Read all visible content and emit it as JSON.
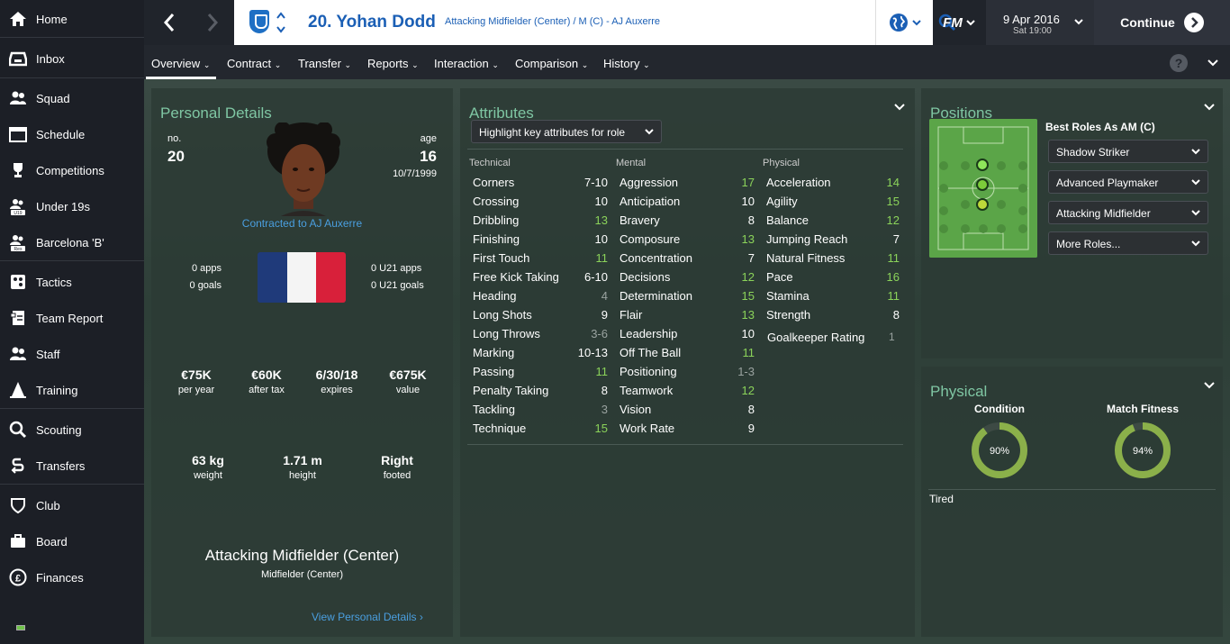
{
  "sidebar": {
    "items": [
      {
        "label": "Home",
        "icon": "home-icon"
      },
      {
        "label": "Inbox",
        "icon": "inbox-icon"
      },
      {
        "label": "Squad",
        "icon": "squad-icon"
      },
      {
        "label": "Schedule",
        "icon": "calendar-icon"
      },
      {
        "label": "Competitions",
        "icon": "trophy-icon"
      },
      {
        "label": "Under 19s",
        "icon": "under19-icon",
        "badge": "U19"
      },
      {
        "label": "Barcelona 'B'",
        "icon": "reserves-icon",
        "badge": "Res"
      },
      {
        "label": "Tactics",
        "icon": "tactics-icon"
      },
      {
        "label": "Team Report",
        "icon": "report-icon"
      },
      {
        "label": "Staff",
        "icon": "staff-icon"
      },
      {
        "label": "Training",
        "icon": "training-icon"
      },
      {
        "label": "Scouting",
        "icon": "search-icon"
      },
      {
        "label": "Transfers",
        "icon": "transfers-icon"
      },
      {
        "label": "Club",
        "icon": "shield-icon"
      },
      {
        "label": "Board",
        "icon": "briefcase-icon"
      },
      {
        "label": "Finances",
        "icon": "pound-icon"
      }
    ]
  },
  "header": {
    "player_title": "20. Yohan Dodd",
    "player_position": "Attacking Midfielder (Center) / M (C) - AJ Auxerre",
    "brand": "FM",
    "date": "9 Apr 2016",
    "time": "Sat 19:00",
    "continue_label": "Continue"
  },
  "tabs": [
    "Overview",
    "Contract",
    "Transfer",
    "Reports",
    "Interaction",
    "Comparison",
    "History"
  ],
  "help_label": "?",
  "personal": {
    "title": "Personal Details",
    "no_label": "no.",
    "no_value": "20",
    "age_label": "age",
    "age_value": "16",
    "dob": "10/7/1999",
    "contract_text": "Contracted to AJ Auxerre",
    "apps": "0 apps",
    "goals": "0 goals",
    "u21_apps": "0 U21 apps",
    "u21_goals": "0 U21 goals",
    "wage": "€75K",
    "wage_label": "per year",
    "after_tax": "€60K",
    "after_tax_label": "after tax",
    "expires": "6/30/18",
    "expires_label": "expires",
    "value": "€675K",
    "value_label": "value",
    "weight": "63 kg",
    "weight_label": "weight",
    "height": "1.71 m",
    "height_label": "height",
    "foot": "Right",
    "foot_label": "footed",
    "main_position": "Attacking Midfielder (Center)",
    "sub_position": "Midfielder (Center)",
    "view_link": "View Personal Details"
  },
  "attributes": {
    "title": "Attributes",
    "highlight_label": "Highlight key attributes for role",
    "technical_label": "Technical",
    "mental_label": "Mental",
    "physical_label": "Physical",
    "technical": [
      [
        "Corners",
        "7-10"
      ],
      [
        "Crossing",
        "10"
      ],
      [
        "Dribbling",
        "13"
      ],
      [
        "Finishing",
        "10"
      ],
      [
        "First Touch",
        "11"
      ],
      [
        "Free Kick Taking",
        "6-10"
      ],
      [
        "Heading",
        "4"
      ],
      [
        "Long Shots",
        "9"
      ],
      [
        "Long Throws",
        "3-6"
      ],
      [
        "Marking",
        "10-13"
      ],
      [
        "Passing",
        "11"
      ],
      [
        "Penalty Taking",
        "8"
      ],
      [
        "Tackling",
        "3"
      ],
      [
        "Technique",
        "15"
      ]
    ],
    "mental": [
      [
        "Aggression",
        "17"
      ],
      [
        "Anticipation",
        "10"
      ],
      [
        "Bravery",
        "8"
      ],
      [
        "Composure",
        "13"
      ],
      [
        "Concentration",
        "7"
      ],
      [
        "Decisions",
        "12"
      ],
      [
        "Determination",
        "15"
      ],
      [
        "Flair",
        "13"
      ],
      [
        "Leadership",
        "10"
      ],
      [
        "Off The Ball",
        "11"
      ],
      [
        "Positioning",
        "1-3"
      ],
      [
        "Teamwork",
        "12"
      ],
      [
        "Vision",
        "8"
      ],
      [
        "Work Rate",
        "9"
      ]
    ],
    "physical": [
      [
        "Acceleration",
        "14"
      ],
      [
        "Agility",
        "15"
      ],
      [
        "Balance",
        "12"
      ],
      [
        "Jumping Reach",
        "7"
      ],
      [
        "Natural Fitness",
        "11"
      ],
      [
        "Pace",
        "16"
      ],
      [
        "Stamina",
        "11"
      ],
      [
        "Strength",
        "8"
      ]
    ],
    "goalkeeper_label": "Goalkeeper Rating",
    "goalkeeper_value": "1"
  },
  "positions": {
    "title": "Positions",
    "best_roles": "Best Roles As AM (C)",
    "roles": [
      "Shadow Striker",
      "Advanced Playmaker",
      "Attacking Midfielder",
      "More Roles..."
    ]
  },
  "physical": {
    "title": "Physical",
    "condition_label": "Condition",
    "condition_value": "90%",
    "condition_fraction": 0.9,
    "fitness_label": "Match Fitness",
    "fitness_value": "94%",
    "fitness_fraction": 0.94,
    "status": "Tired"
  },
  "colors": {
    "accent_green": "#7fc6a3",
    "good_value": "#8bd35a",
    "low_value": "#9aa3a0",
    "link_blue": "#4a9fe0"
  }
}
